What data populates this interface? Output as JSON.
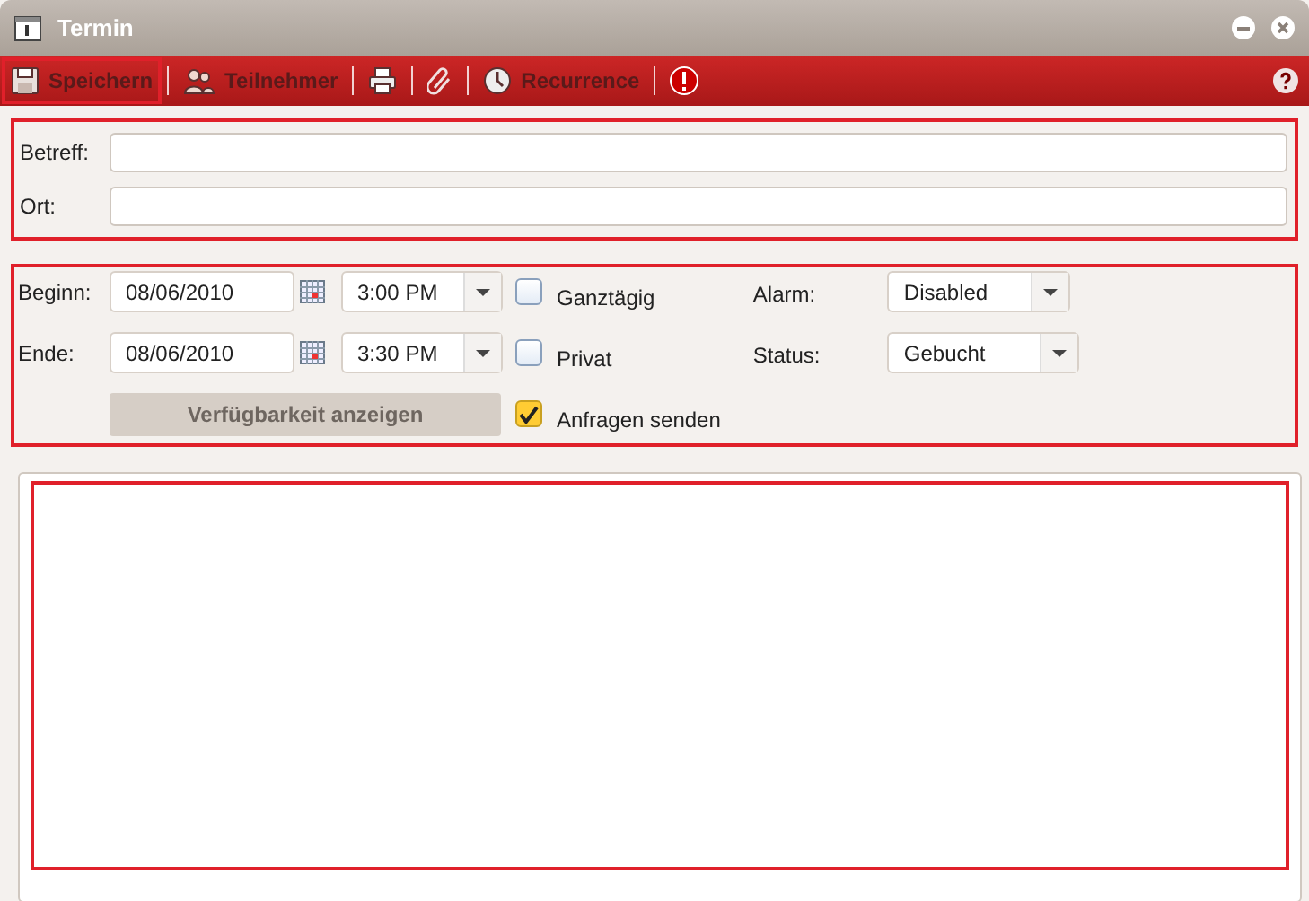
{
  "window": {
    "title": "Termin"
  },
  "toolbar": [
    {
      "kind": "save",
      "label": "Speichern",
      "highlighted": true
    },
    {
      "kind": "people",
      "label": "Teilnehmer",
      "highlighted": false
    },
    {
      "kind": "print",
      "highlighted": false
    },
    {
      "kind": "attach",
      "highlighted": false
    },
    {
      "kind": "clock",
      "label": "Recurrence",
      "highlighted": false
    },
    {
      "kind": "alert",
      "highlighted": false
    }
  ],
  "subject": {
    "label": "Betreff:"
  },
  "location": {
    "label": "Ort:"
  },
  "start": {
    "label": "Beginn:",
    "date": "08/06/2010",
    "time": "3:00 PM"
  },
  "end": {
    "label": "Ende:",
    "date": "08/06/2010",
    "time": "3:30 PM"
  },
  "availability_button": {
    "label": "Verfügbarkeit anzeigen",
    "disabled": true
  },
  "checkboxes": [
    {
      "label": "Ganztägig",
      "checked": false
    },
    {
      "label": "Privat",
      "checked": false
    },
    {
      "label": "Anfragen senden",
      "checked": true
    }
  ],
  "alarm": {
    "label": "Alarm:",
    "value": "Disabled"
  },
  "status": {
    "label": "Status:",
    "value": "Gebucht"
  }
}
